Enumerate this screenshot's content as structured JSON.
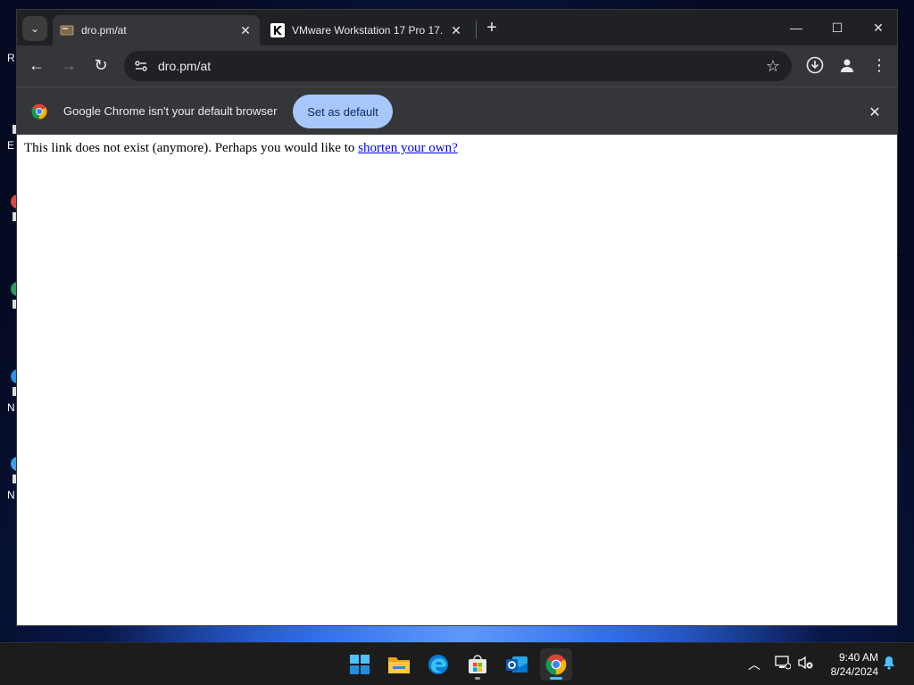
{
  "desktop": {
    "edge_letters": [
      "R",
      "E",
      "N",
      "N"
    ]
  },
  "browser": {
    "tabs": [
      {
        "title": "dro.pm/at",
        "active": true,
        "favicon": "page-favicon-icon"
      },
      {
        "title": "VMware Workstation 17 Pro 17.",
        "active": false,
        "favicon": "k-favicon-icon"
      }
    ],
    "close_tab_glyph": "✕",
    "new_tab_glyph": "+",
    "window_controls": {
      "minimize": "—",
      "maximize": "☐",
      "close": "✕"
    },
    "toolbar": {
      "url": "dro.pm/at",
      "back_glyph": "←",
      "forward_glyph": "→",
      "reload_glyph": "↻",
      "bookmark_glyph": "☆"
    },
    "infobar": {
      "message": "Google Chrome isn't your default browser",
      "button_label": "Set as default",
      "close_glyph": "✕"
    }
  },
  "page": {
    "text": "This link does not exist (anymore). Perhaps you would like to ",
    "link_text": "shorten your own?"
  },
  "taskbar": {
    "apps": [
      "start-icon",
      "file-explorer-icon",
      "edge-icon",
      "store-icon",
      "outlook-icon",
      "chrome-icon"
    ],
    "active_app": "chrome-icon",
    "clock_time": "9:40 AM",
    "clock_date": "8/24/2024"
  },
  "colors": {
    "chrome_dark": "#202124",
    "chrome_toolbar": "#35363a",
    "accent_button": "#a8c7fa",
    "link": "#0000ee",
    "taskbar": "#1c1c1c",
    "active_indicator": "#4cc2ff"
  }
}
